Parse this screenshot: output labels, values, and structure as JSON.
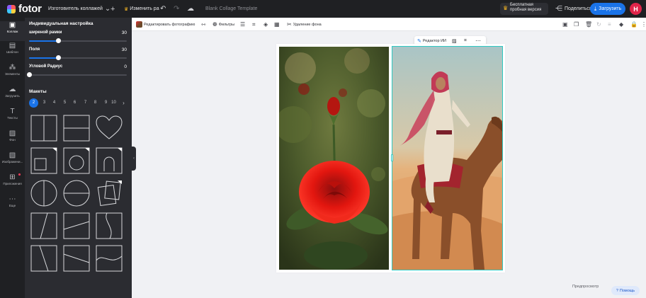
{
  "topbar": {
    "logo_text": "fotor",
    "app_menu": "Изготовитель коллажей",
    "app_menu_icon": "chevron-down-icon",
    "add_icon": "plus-icon",
    "resize_label": "Изменить ра",
    "doc_title": "Blank Collage Template",
    "upgrade_line1": "Бесплатная",
    "upgrade_line2": "пробная версия",
    "share_label": "Поделиться",
    "upload_label": "Загрузить",
    "avatar_letter": "H",
    "accent": "#1a73e8"
  },
  "rail": {
    "items": [
      {
        "label": "Коллаж",
        "icon": "collage-icon",
        "glyph": "▣"
      },
      {
        "label": "Шаблон",
        "icon": "template-icon",
        "glyph": "▤"
      },
      {
        "label": "Элементы",
        "icon": "elements-icon",
        "glyph": "⁂"
      },
      {
        "label": "Загрузить",
        "icon": "cloud-upload-icon",
        "glyph": "☁"
      },
      {
        "label": "Тексты",
        "icon": "text-icon",
        "glyph": "T"
      },
      {
        "label": "Фон",
        "icon": "background-icon",
        "glyph": "▨"
      },
      {
        "label": "Изображени...",
        "icon": "image-icon",
        "glyph": "▧"
      },
      {
        "label": "Приложения",
        "icon": "apps-icon",
        "glyph": "⊞"
      },
      {
        "label": "Еще",
        "icon": "more-icon",
        "glyph": "⋯"
      }
    ]
  },
  "panel": {
    "title": "Индивидуальная настройка",
    "border_width": {
      "label": "ширеной рамки",
      "value": "30",
      "level": 0.3
    },
    "padding": {
      "label": "Поля",
      "value": "30",
      "level": 0.3
    },
    "corner_radius": {
      "label": "Угловой Радиус",
      "value": "0",
      "level": 0.0
    },
    "layouts_title": "Макеты",
    "pages": [
      "2",
      "3",
      "4",
      "5",
      "6",
      "7",
      "8",
      "9",
      "10"
    ],
    "active_page": "2",
    "next_icon": "chevron-right-icon"
  },
  "toolbar": {
    "edit_photo": "Редактировать фотографию",
    "filters": "Фильтры",
    "remove_bg": "Удаление фона"
  },
  "float_bar": {
    "ai_editor": "Редактор ИИ"
  },
  "footer": {
    "preview": "Предпросмотр",
    "help": "Помощь"
  }
}
